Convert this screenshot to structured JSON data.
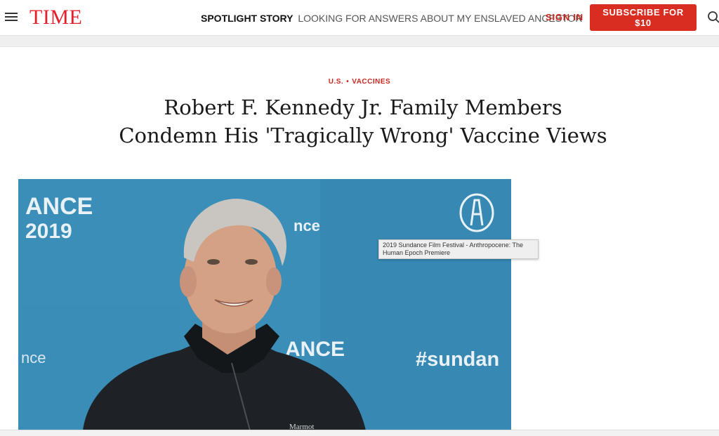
{
  "header": {
    "logo": "TIME",
    "spotlight_label": "SPOTLIGHT STORY",
    "spotlight_link": "LOOKING FOR ANSWERS ABOUT MY ENSLAVED ANCESTOR",
    "sign_in": "SIGN IN",
    "subscribe": "SUBSCRIBE FOR $10",
    "menu_icon": "hamburger-menu-icon",
    "search_icon": "search-icon"
  },
  "article": {
    "kicker": [
      "U.S.",
      "VACCINES"
    ],
    "headline_line1": "Robert F. Kennedy Jr. Family Members",
    "headline_line2": "Condemn His 'Tragically Wrong' Vaccine Views"
  },
  "photo": {
    "backdrop_text": {
      "ance": "ANCE",
      "year": "2019",
      "nce": "nce",
      "ance2": "ANCE",
      "sundance": "#sundan",
      "nce_left": "nce"
    },
    "jacket_text": "Marmot",
    "tooltip": "2019 Sundance Film Festival - Anthropocene: The Human Epoch Premiere"
  },
  "colors": {
    "brand_red": "#e4202c",
    "button_red": "#d82d20",
    "backdrop_blue": "#3a8bb4"
  }
}
